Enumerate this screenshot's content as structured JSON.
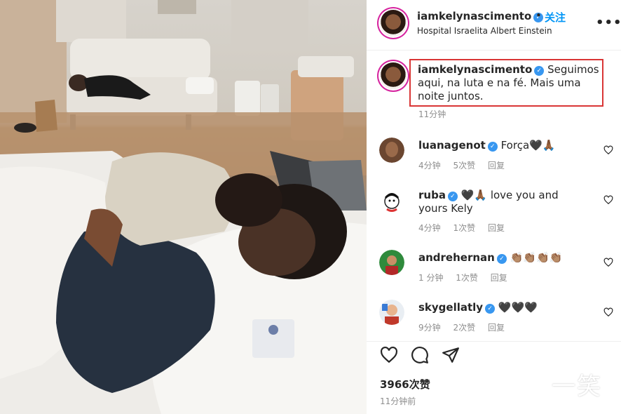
{
  "post": {
    "username": "iamkelynascimento",
    "dot": "•",
    "follow_label": "关注",
    "location": "Hospital Israelita Albert Einstein",
    "more_icon": "more-horizontal-icon",
    "more_label": "•••"
  },
  "caption": {
    "username": "iamkelynascimento",
    "text": "Seguimos aqui, na luta e na fé. Mais uma noite juntos.",
    "time": "11分钟"
  },
  "comments": [
    {
      "username": "luanagenot",
      "text": "Força🖤🙏🏾",
      "time": "4分钟",
      "likes": "5次赞",
      "reply": "回复"
    },
    {
      "username": "ruba",
      "text": "🖤🙏🏾 love you and yours Kely",
      "time": "4分钟",
      "likes": "1次赞",
      "reply": "回复"
    },
    {
      "username": "andrehernan",
      "text": "👏🏽👏🏽👏🏽👏🏽",
      "time": "1 分钟",
      "likes": "1次赞",
      "reply": "回复"
    },
    {
      "username": "skygellatly",
      "text": "🖤🖤🖤",
      "time": "9分钟",
      "likes": "2次赞",
      "reply": "回复"
    }
  ],
  "actions": {
    "like_icon": "heart-icon",
    "comment_icon": "comment-icon",
    "share_icon": "share-icon",
    "likes": "3966次赞",
    "time": "11分钟前"
  },
  "watermark": "一笑",
  "colors": {
    "verified": "#3897f0",
    "follow": "#0095f6",
    "highlight_border": "#d93636",
    "meta": "#8e8e8e"
  }
}
